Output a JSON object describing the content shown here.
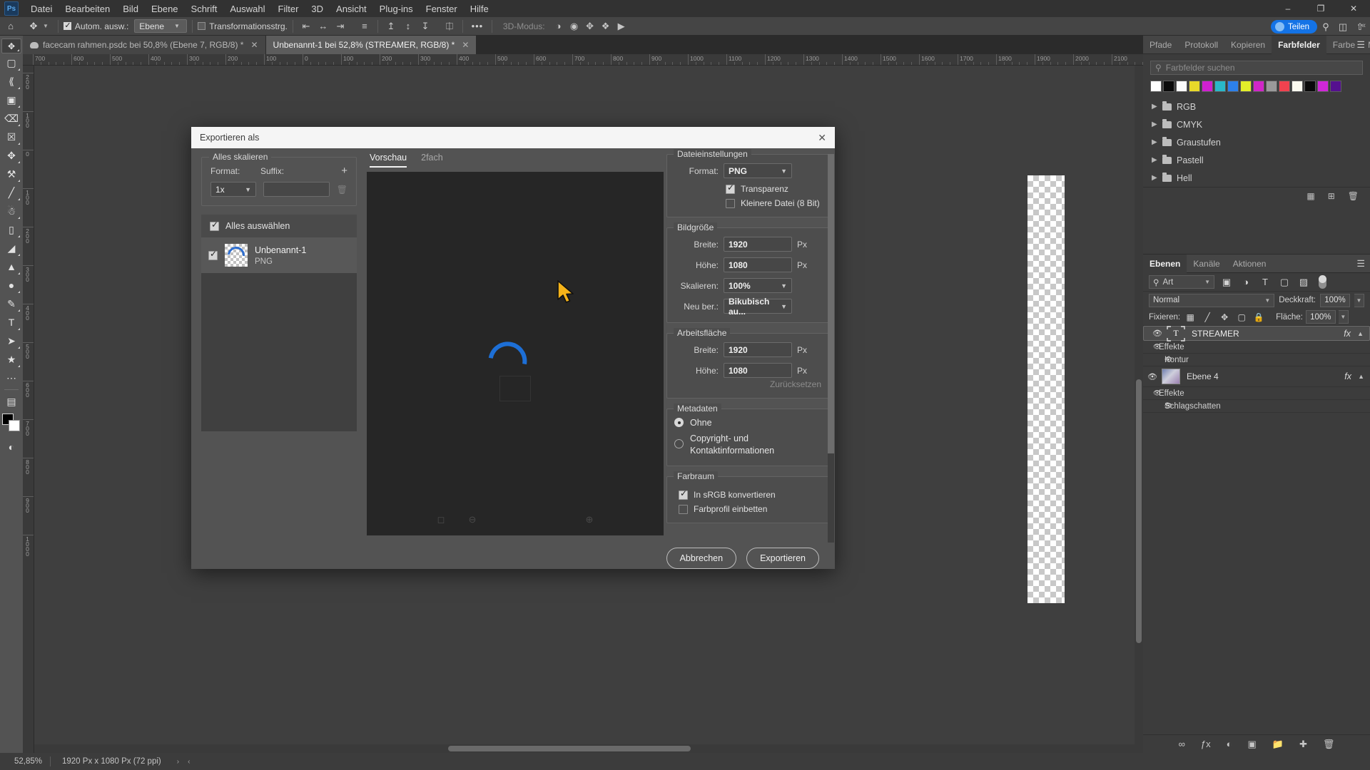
{
  "menu": {
    "logo": "Ps",
    "items": [
      "Datei",
      "Bearbeiten",
      "Bild",
      "Ebene",
      "Schrift",
      "Auswahl",
      "Filter",
      "3D",
      "Ansicht",
      "Plug-ins",
      "Fenster",
      "Hilfe"
    ],
    "window_controls": [
      "minimize",
      "maximize",
      "close"
    ]
  },
  "options_bar": {
    "home_icon": "home-icon",
    "tool_icon": "move-tool-icon",
    "auto_select": {
      "label": "Autom. ausw.:",
      "checked": true
    },
    "auto_select_scope": "Ebene",
    "transform_controls": {
      "label": "Transformationsstrg.",
      "checked": false
    },
    "align_icons": [
      "align-left-edges",
      "align-horizontal-centers",
      "align-right-edges",
      "distribute-horizontal",
      "align-top-edges",
      "align-vertical-centers",
      "align-bottom-edges",
      "distribute-vertical"
    ],
    "more_label": "•••",
    "mode_3d_label": "3D-Modus:",
    "mode_3d_icons": [
      "orbit-3d-icon",
      "roll-3d-icon",
      "pan-3d-icon",
      "slide-3d-icon",
      "camera-3d-icon"
    ],
    "share_label": "Teilen",
    "right_icons": [
      "search-icon",
      "workspace-icon",
      "share-export-icon"
    ]
  },
  "document_tabs": [
    {
      "label": "facecam rahmen.psdc bei 50,8% (Ebene 7, RGB/8) *",
      "active": false,
      "cloud": true
    },
    {
      "label": "Unbenannt-1 bei 52,8% (STREAMER, RGB/8) *",
      "active": true,
      "cloud": false
    }
  ],
  "toolbar_tools": [
    "move-tool",
    "rectangular-marquee-tool",
    "lasso-tool",
    "object-selection-tool",
    "crop-tool",
    "frame-tool",
    "eyedropper-tool",
    "spot-healing-brush-tool",
    "brush-tool",
    "clone-stamp-tool",
    "eraser-tool",
    "gradient-tool",
    "blur-tool",
    "dodge-tool",
    "pen-tool",
    "type-tool",
    "path-selection-tool",
    "shape-tool",
    "more-tools",
    "screen-mode",
    "quick-mask"
  ],
  "ruler": {
    "horizontal_labels": [
      "700",
      "600",
      "500",
      "400",
      "300",
      "200",
      "100",
      "0",
      "100",
      "200",
      "300",
      "400",
      "500",
      "600",
      "700",
      "800",
      "900",
      "1000",
      "1100",
      "1200",
      "1300",
      "1400",
      "1500",
      "1600",
      "1700",
      "1800",
      "1900",
      "2000",
      "2100"
    ],
    "vertical_labels": [
      "200",
      "100",
      "0",
      "100",
      "200",
      "300",
      "400",
      "500",
      "600",
      "700",
      "800",
      "900",
      "1000"
    ]
  },
  "status_bar": {
    "zoom": "52,85%",
    "dimensions": "1920 Px x 1080 Px (72 ppi)",
    "arrow_right": "›",
    "arrow_left": "‹"
  },
  "swatches_panel": {
    "tabs": [
      {
        "label": "Pfade",
        "active": false
      },
      {
        "label": "Protokoll",
        "active": false
      },
      {
        "label": "Kopieren",
        "active": false
      },
      {
        "label": "Farbfelder",
        "active": true
      },
      {
        "label": "Farbe",
        "active": false
      },
      {
        "label": "Muster",
        "active": false
      }
    ],
    "search_placeholder": "Farbfelder suchen",
    "search_icon": "search-icon",
    "menu_icon": "panel-menu-icon",
    "swatch_colors": [
      "#ffffff",
      "#0a0a0a",
      "#fbfbfb",
      "#e8d92a",
      "#d020d0",
      "#2ab8c8",
      "#2d80ea",
      "#e2ee2a",
      "#d026c8",
      "#9a9a9a",
      "#f0424f",
      "#fafaf0",
      "#090909",
      "#d028d8",
      "#55108f"
    ],
    "folders": [
      "RGB",
      "CMYK",
      "Graustufen",
      "Pastell",
      "Hell"
    ],
    "footer_icons": [
      "new-folder-icon",
      "new-swatch-icon",
      "delete-swatch-icon"
    ]
  },
  "layers_panel": {
    "tabs": [
      {
        "label": "Ebenen",
        "active": true
      },
      {
        "label": "Kanäle",
        "active": false
      },
      {
        "label": "Aktionen",
        "active": false
      }
    ],
    "menu_icon": "panel-menu-icon",
    "filter_label": "Art",
    "filter_icons": [
      "filter-image-icon",
      "filter-adjustment-icon",
      "filter-type-icon",
      "filter-shape-icon",
      "filter-smart-object-icon"
    ],
    "filter_toggle": "filter-toggle-switch",
    "blend_mode": "Normal",
    "opacity_label": "Deckkraft:",
    "opacity_value": "100%",
    "lock_label": "Fixieren:",
    "lock_icons": [
      "lock-transparency-icon",
      "lock-image-icon",
      "lock-position-icon",
      "lock-artboard-icon",
      "lock-all-icon"
    ],
    "fill_label": "Fläche:",
    "fill_value": "100%",
    "layers": [
      {
        "name": "STREAMER",
        "type": "text",
        "visible": true,
        "selected": true,
        "fx": "fx",
        "effects_label": "Effekte",
        "effects": [
          "Kontur"
        ]
      },
      {
        "name": "Ebene 4",
        "type": "image",
        "visible": true,
        "selected": false,
        "fx": "fx",
        "effects_label": "Effekte",
        "effects": [
          "Schlagschatten"
        ]
      }
    ],
    "footer_icons": [
      "link-layers-icon",
      "add-style-icon",
      "add-mask-icon",
      "new-group-icon",
      "new-layer-icon",
      "delete-layer-icon"
    ]
  },
  "export_dialog": {
    "title": "Exportieren als",
    "close_icon": "close-icon",
    "scale_all": {
      "title": "Alles skalieren",
      "format_label": "Format:",
      "suffix_label": "Suffix:",
      "format_value": "1x",
      "suffix_value": "",
      "add_icon": "plus-icon",
      "delete_icon": "trash-icon"
    },
    "select_all": {
      "label": "Alles auswählen",
      "checked": true
    },
    "file_item": {
      "name": "Unbenannt-1",
      "format": "PNG",
      "checked": true
    },
    "preview": {
      "tabs": [
        {
          "label": "Vorschau",
          "active": true
        },
        {
          "label": "2fach",
          "active": false
        }
      ],
      "footer_icons": [
        "clip-icon",
        "zoom-out-icon",
        "zoom-in-icon"
      ]
    },
    "file_settings": {
      "title": "Dateieinstellungen",
      "format_label": "Format:",
      "format_value": "PNG",
      "transparency": {
        "label": "Transparenz",
        "checked": true
      },
      "smaller_file": {
        "label": "Kleinere Datei (8 Bit)",
        "checked": false
      }
    },
    "image_size": {
      "title": "Bildgröße",
      "width_label": "Breite:",
      "width_value": "1920",
      "height_label": "Höhe:",
      "height_value": "1080",
      "unit": "Px",
      "scale_label": "Skalieren:",
      "scale_value": "100%",
      "resample_label": "Neu ber.:",
      "resample_value": "Bikubisch au..."
    },
    "canvas_size": {
      "title": "Arbeitsfläche",
      "width_label": "Breite:",
      "width_value": "1920",
      "height_label": "Höhe:",
      "height_value": "1080",
      "unit": "Px",
      "reset_label": "Zurücksetzen"
    },
    "metadata": {
      "title": "Metadaten",
      "options": [
        {
          "label": "Ohne",
          "selected": true
        },
        {
          "label": "Copyright- und Kontaktinformationen",
          "selected": false
        }
      ]
    },
    "color_space": {
      "title": "Farbraum",
      "convert_srgb": {
        "label": "In sRGB konvertieren",
        "checked": true
      },
      "embed_profile": {
        "label": "Farbprofil einbetten",
        "checked": false
      }
    },
    "cancel_label": "Abbrechen",
    "export_label": "Exportieren"
  },
  "colors": {
    "accent_blue": "#1473e6",
    "spinner_blue": "#1d6fd6",
    "panel_bg": "#3c3c3c",
    "dialog_bg": "#535353",
    "canvas_bg": "#3f3f3f"
  }
}
